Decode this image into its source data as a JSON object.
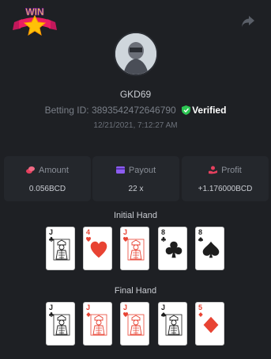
{
  "header": {
    "badge_text": "WIN",
    "badge_icon": "star-badge-icon",
    "share_icon": "share-arrow-icon"
  },
  "profile": {
    "avatar_icon": "user-avatar",
    "username": "GKD69",
    "betting_id_label": "Betting ID:",
    "betting_id": "3893542472646790",
    "verified_label": "Verified",
    "verified_color": "#2dc653",
    "timestamp": "12/21/2021, 7:12:27 AM"
  },
  "stats": {
    "amount": {
      "label": "Amount",
      "value": "0.056BCD",
      "icon": "coins-icon",
      "icon_color": "#e5405e"
    },
    "payout": {
      "label": "Payout",
      "value": "22 x",
      "icon": "wallet-icon",
      "icon_color": "#8c5cf0"
    },
    "profit": {
      "label": "Profit",
      "value": "+1.176000BCD",
      "icon": "hand-coins-icon",
      "icon_color": "#e5405e"
    }
  },
  "initial_hand": {
    "title": "Initial Hand",
    "cards": [
      {
        "rank": "J",
        "suit": "clubs",
        "color": "black"
      },
      {
        "rank": "4",
        "suit": "hearts",
        "color": "red"
      },
      {
        "rank": "J",
        "suit": "hearts",
        "color": "red"
      },
      {
        "rank": "8",
        "suit": "clubs",
        "color": "black"
      },
      {
        "rank": "8",
        "suit": "spades",
        "color": "black"
      }
    ]
  },
  "final_hand": {
    "title": "Final Hand",
    "cards": [
      {
        "rank": "J",
        "suit": "clubs",
        "color": "black"
      },
      {
        "rank": "J",
        "suit": "diamonds",
        "color": "red"
      },
      {
        "rank": "J",
        "suit": "hearts",
        "color": "red"
      },
      {
        "rank": "J",
        "suit": "spades",
        "color": "black"
      },
      {
        "rank": "5",
        "suit": "diamonds",
        "color": "red"
      }
    ]
  }
}
